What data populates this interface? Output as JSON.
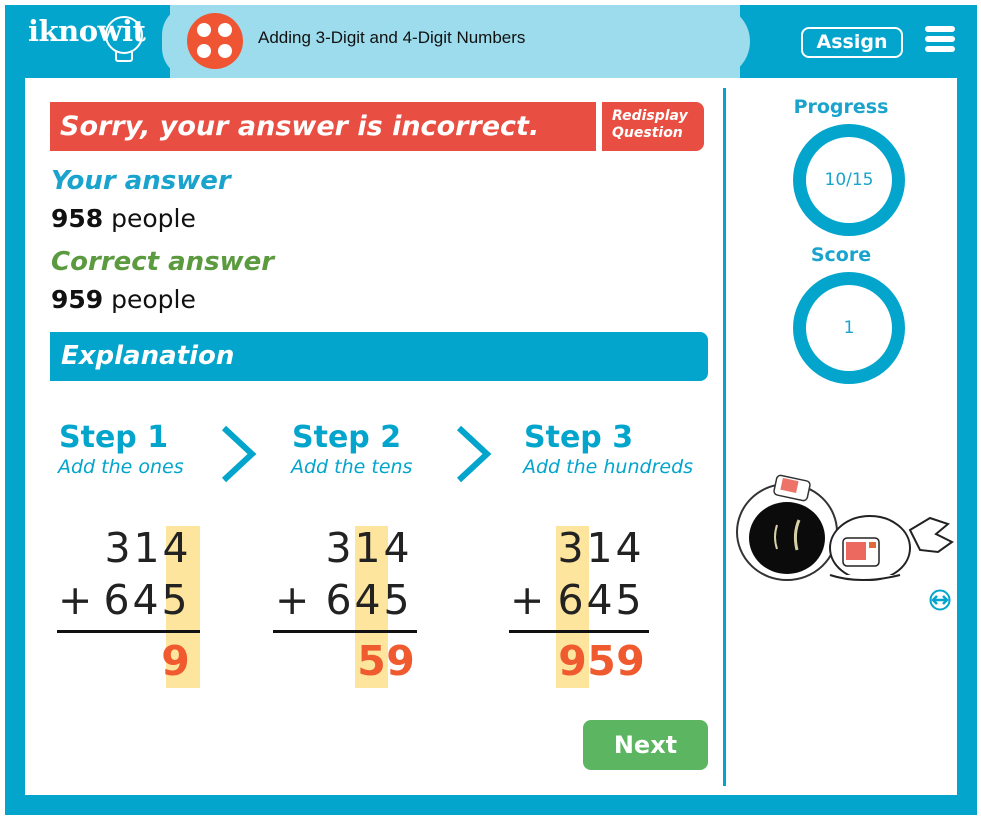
{
  "header": {
    "logo": "iknowit",
    "topic_icon": "four-dots-icon",
    "topic_title": "Adding 3-Digit and 4-Digit Numbers",
    "assign_label": "Assign",
    "menu_icon": "hamburger-menu-icon"
  },
  "feedback": {
    "banner": "Sorry, your answer is incorrect.",
    "redisplay_line1": "Redisplay",
    "redisplay_line2": "Question",
    "your_answer_label": "Your answer",
    "your_answer_value": "958",
    "your_answer_unit": "people",
    "correct_answer_label": "Correct answer",
    "correct_answer_value": "959",
    "correct_answer_unit": "people"
  },
  "explanation": {
    "title": "Explanation",
    "steps": [
      {
        "title": "Step 1",
        "subtitle": "Add the ones",
        "top": "314",
        "bottom": "645",
        "operator": "+",
        "result": "9",
        "highlight_column": "ones"
      },
      {
        "title": "Step 2",
        "subtitle": "Add the tens",
        "top": "314",
        "bottom": "645",
        "operator": "+",
        "result": "59",
        "highlight_column": "tens"
      },
      {
        "title": "Step 3",
        "subtitle": "Add the hundreds",
        "top": "314",
        "bottom": "645",
        "operator": "+",
        "result": "959",
        "highlight_column": "hundreds"
      }
    ]
  },
  "sidebar": {
    "progress_label": "Progress",
    "progress_value": "10/15",
    "progress_current": 10,
    "progress_total": 15,
    "score_label": "Score",
    "score_value": "1",
    "mascot": "sleeping-astronaut-illustration",
    "resize_icon": "horizontal-resize-icon"
  },
  "actions": {
    "next_label": "Next"
  },
  "colors": {
    "brand_blue": "#03a5cc",
    "title_bg": "#9cdcec",
    "error_red": "#e84f42",
    "correct_green": "#5b9a3f",
    "next_green": "#5cb561",
    "highlight": "#fde59d",
    "result_orange": "#ef5a2e"
  }
}
